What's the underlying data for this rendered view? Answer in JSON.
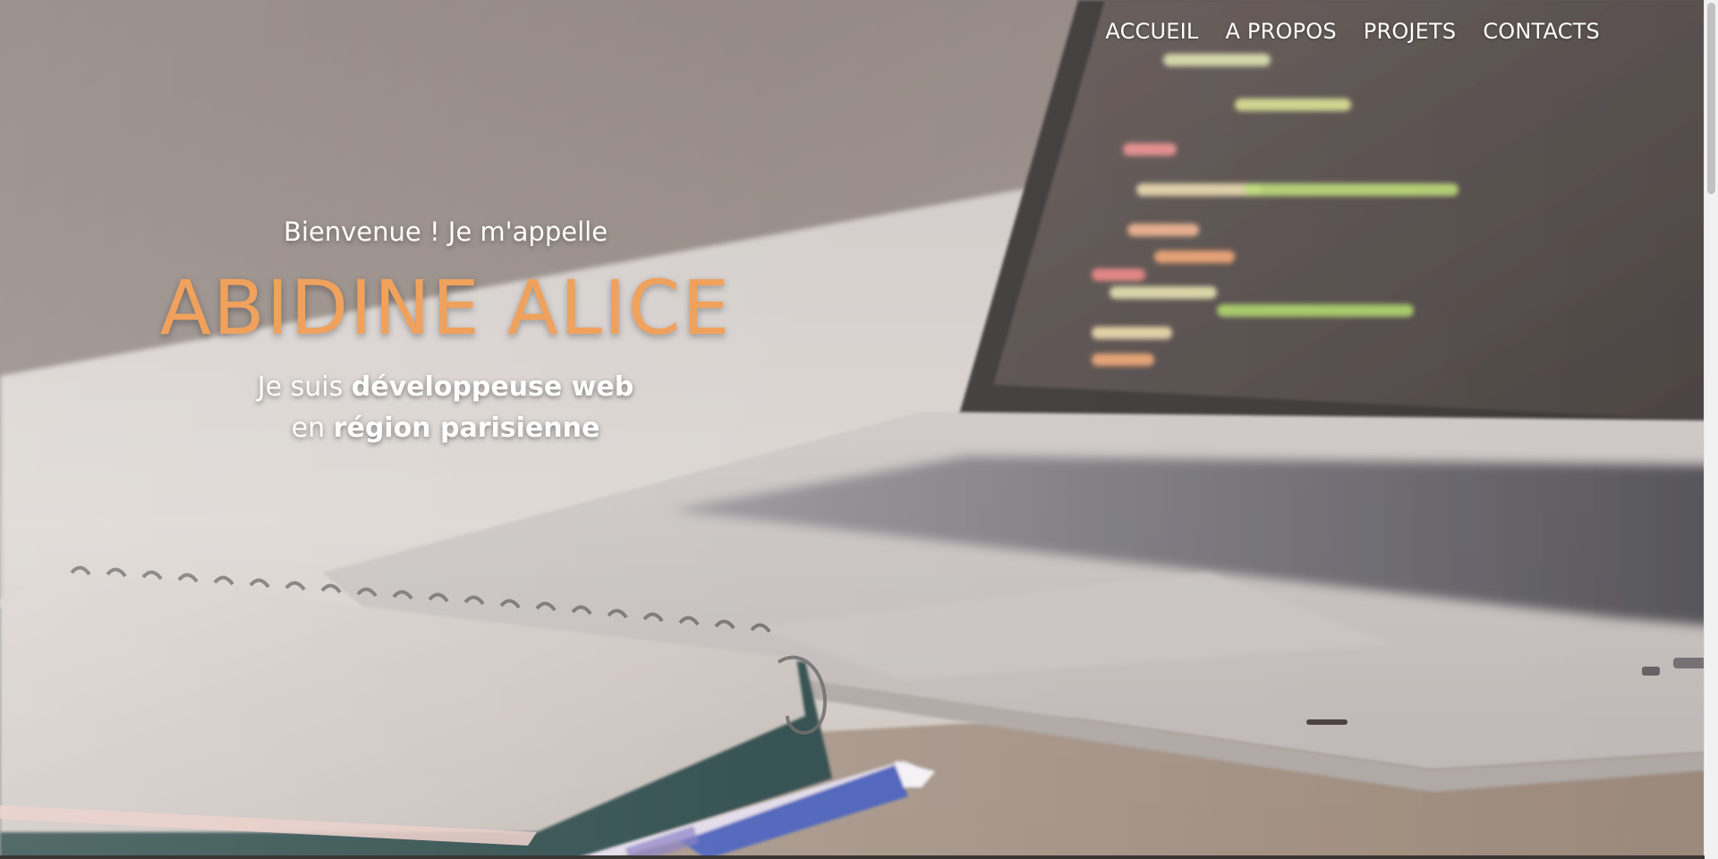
{
  "nav": {
    "items": [
      {
        "label": "ACCUEIL"
      },
      {
        "label": "A PROPOS"
      },
      {
        "label": "PROJETS"
      },
      {
        "label": "CONTACTS"
      }
    ]
  },
  "hero": {
    "welcome": "Bienvenue ! Je m'appelle",
    "name": "ABIDINE ALICE",
    "line1_prefix": "Je suis ",
    "line1_bold": "développeuse web",
    "line2_prefix": "en ",
    "line2_bold": "région parisienne"
  },
  "colors": {
    "accent": "#f0a25d",
    "nav_text": "#ffffff",
    "hero_text": "#ffffff"
  },
  "background": {
    "image": "desk-with-laptop-notebook-pen"
  }
}
